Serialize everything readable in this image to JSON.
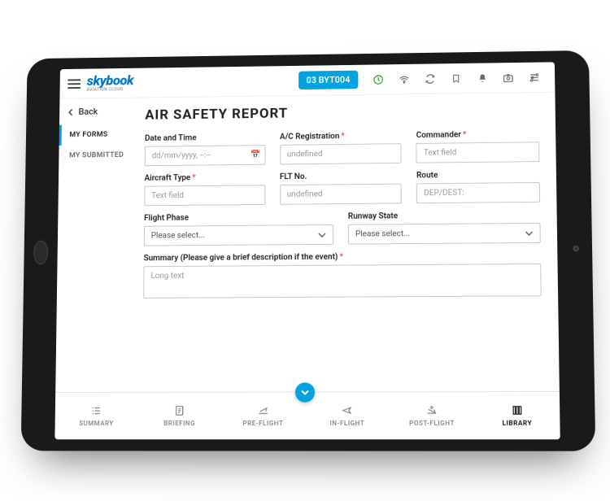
{
  "brand": {
    "name": "skybook",
    "sub": "AVIATION CLOUD"
  },
  "topbar": {
    "flight_badge": "03 BYT004",
    "icons": [
      "refresh-circle",
      "wifi",
      "sync",
      "bookmark",
      "bell",
      "camera",
      "sliders"
    ]
  },
  "back_label": "Back",
  "sidebar": {
    "items": [
      {
        "label": "MY FORMS",
        "active": true
      },
      {
        "label": "MY SUBMITTED",
        "active": false
      }
    ]
  },
  "form": {
    "title": "AIR SAFETY REPORT",
    "fields": {
      "date_time": {
        "label": "Date and Time",
        "placeholder": "dd/mm/yyyy, --:--"
      },
      "ac_reg": {
        "label": "A/C Registration",
        "required": true,
        "placeholder": "undefined"
      },
      "commander": {
        "label": "Commander",
        "required": true,
        "placeholder": "Text field"
      },
      "ac_type": {
        "label": "Aircraft Type",
        "required": true,
        "placeholder": "Text field"
      },
      "flt_no": {
        "label": "FLT No.",
        "placeholder": "undefined"
      },
      "route": {
        "label": "Route",
        "placeholder": "DEP/DEST:"
      },
      "phase": {
        "label": "Flight Phase",
        "placeholder": "Please select..."
      },
      "runway": {
        "label": "Runway State",
        "placeholder": "Please select..."
      },
      "summary": {
        "label": "Summary (Please give a brief description if the event)",
        "required": true,
        "placeholder": "Long text"
      }
    }
  },
  "footer": {
    "tabs": [
      {
        "label": "SUMMARY"
      },
      {
        "label": "BRIEFING"
      },
      {
        "label": "PRE-FLIGHT"
      },
      {
        "label": "IN-FLIGHT"
      },
      {
        "label": "POST-FLIGHT"
      },
      {
        "label": "LIBRARY",
        "active": true
      }
    ]
  }
}
